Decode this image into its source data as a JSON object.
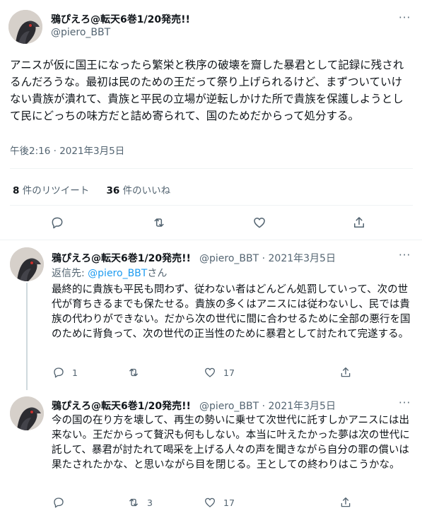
{
  "main_tweet": {
    "author_name": "鴉ぴえろ@転天6巻1/20発売!!",
    "author_handle": "@piero_BBT",
    "text": "アニスが仮に国王になったら繁栄と秩序の破壊を齎した暴君として記録に残されるんだろうな。最初は民のための王だって祭り上げられるけど、まずついていけない貴族が潰れて、貴族と平民の立場が逆転しかけた所で貴族を保護しようとして民にどっちの味方だと詰め寄られて、国のためだからって処分する。",
    "timestamp": "午後2:16 · 2021年3月5日",
    "retweet_count": "8",
    "retweet_label": "件のリツイート",
    "like_count": "36",
    "like_label": "件のいいね",
    "more_label": "···"
  },
  "replies": [
    {
      "author_name": "鴉ぴえろ@転天6巻1/20発売!!",
      "meta": "@piero_BBT · 2021年3月5日",
      "replying_prefix": "返信先: ",
      "replying_handle": "@piero_BBT",
      "replying_suffix": "さん",
      "text": "最終的に貴族も平民も問わず、従わない者はどんどん処罰していって、次の世代が育ちきるまでも保たせる。貴族の多くはアニスには従わないし、民では貴族の代わりができない。だから次の世代に間に合わせるために全部の悪行を国のために背負って、次の世代の正当性のために暴君として討たれて完遂する。",
      "reply_count": "1",
      "retweet_count": "",
      "like_count": "17",
      "more_label": "···"
    },
    {
      "author_name": "鴉ぴえろ@転天6巻1/20発売!!",
      "meta": "@piero_BBT · 2021年3月5日",
      "text": "今の国の在り方を壊して、再生の勢いに乗せて次世代に託すしかアニスには出来ない。王だからって贅沢も何もしない。本当に叶えたかった夢は次の世代に託して、暴君が討たれて喝采を上げる人々の声を聞きながら自分の罪の償いは果たされたかな、と思いながら目を閉じる。王としての終わりはこうかな。",
      "reply_count": "",
      "retweet_count": "3",
      "like_count": "17",
      "more_label": "···"
    }
  ],
  "icons": [
    "reply-icon",
    "retweet-icon",
    "like-icon",
    "share-icon",
    "more-icon"
  ],
  "colors": {
    "text": "#0f1419",
    "secondary": "#536471",
    "link": "#1d9bf0",
    "divider": "#eff3f4"
  }
}
